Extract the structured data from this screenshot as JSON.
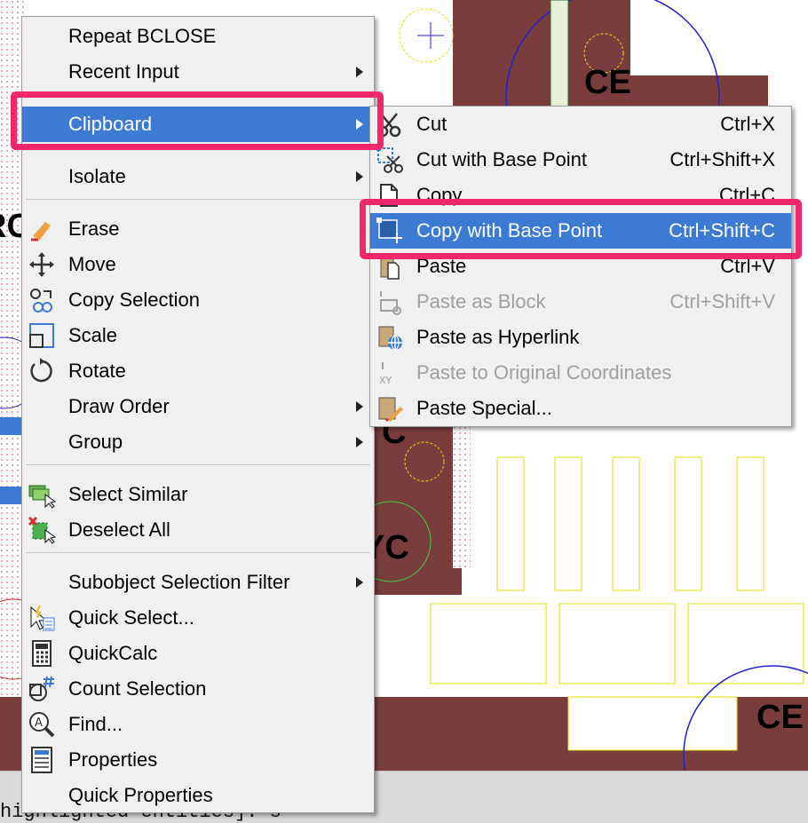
{
  "context_menu": {
    "items": [
      {
        "label": "Repeat BCLOSE"
      },
      {
        "label": "Recent Input"
      },
      {
        "label": "Clipboard"
      },
      {
        "label": "Isolate"
      },
      {
        "label": "Erase",
        "icon": "eraser-icon"
      },
      {
        "label": "Move",
        "icon": "move-icon"
      },
      {
        "label": "Copy Selection",
        "icon": "copy-selection-icon"
      },
      {
        "label": "Scale",
        "icon": "scale-icon"
      },
      {
        "label": "Rotate",
        "icon": "rotate-icon"
      },
      {
        "label": "Draw Order"
      },
      {
        "label": "Group"
      },
      {
        "label": "Select Similar",
        "icon": "select-similar-icon"
      },
      {
        "label": "Deselect All",
        "icon": "deselect-all-icon"
      },
      {
        "label": "Subobject Selection Filter"
      },
      {
        "label": "Quick Select...",
        "icon": "quick-select-icon"
      },
      {
        "label": "QuickCalc",
        "icon": "calculator-icon"
      },
      {
        "label": "Count Selection",
        "icon": "count-selection-icon"
      },
      {
        "label": "Find...",
        "icon": "find-icon"
      },
      {
        "label": "Properties",
        "icon": "properties-icon"
      },
      {
        "label": "Quick Properties"
      }
    ]
  },
  "clipboard_submenu": {
    "items": [
      {
        "label": "Cut",
        "shortcut": "Ctrl+X",
        "icon": "scissors-icon"
      },
      {
        "label": "Cut with Base Point",
        "shortcut": "Ctrl+Shift+X",
        "icon": "cut-base-point-icon"
      },
      {
        "label": "Copy",
        "shortcut": "Ctrl+C",
        "icon": "copy-icon"
      },
      {
        "label": "Copy with Base Point",
        "shortcut": "Ctrl+Shift+C",
        "icon": "copy-base-point-icon"
      },
      {
        "label": "Paste",
        "shortcut": "Ctrl+V",
        "icon": "paste-icon"
      },
      {
        "label": "Paste as Block",
        "shortcut": "Ctrl+Shift+V",
        "icon": "paste-block-icon"
      },
      {
        "label": "Paste as Hyperlink",
        "icon": "paste-hyperlink-icon"
      },
      {
        "label": "Paste to Original Coordinates",
        "icon": "paste-original-coordinates-icon"
      },
      {
        "label": "Paste Special...",
        "icon": "paste-special-icon"
      }
    ]
  },
  "drawing": {
    "labels": [
      "CE",
      "RC",
      "C",
      "YC",
      "CE"
    ]
  },
  "command_line": {
    "text": "highlighted entities]: s"
  },
  "colors": {
    "menu_bg": "#f0f0f0",
    "selection_blue": "#3b7bd4",
    "highlight_pink": "#f0286a",
    "hatch_brown": "#7a3d3d"
  }
}
